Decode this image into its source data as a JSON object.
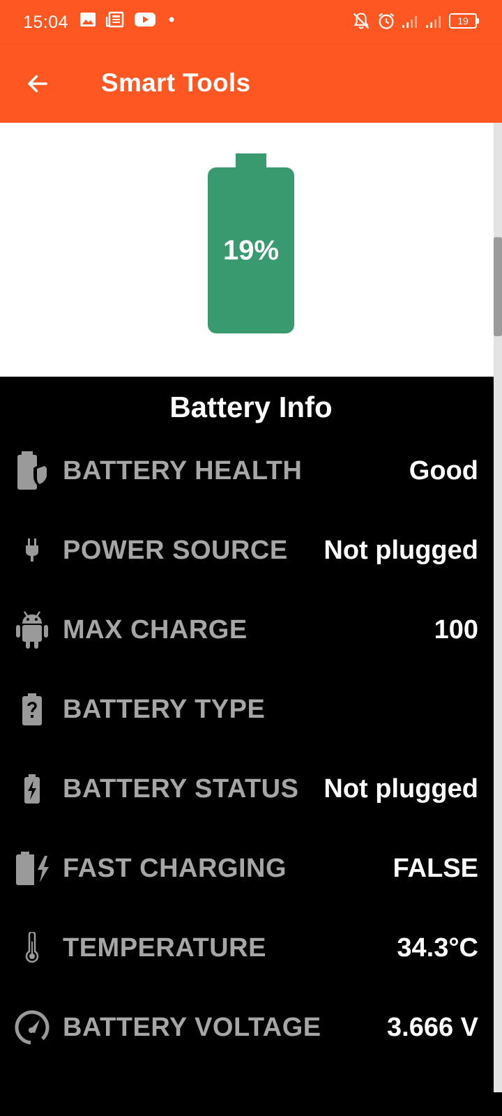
{
  "status_bar": {
    "time": "15:04",
    "battery": "19"
  },
  "app_bar": {
    "title": "Smart Tools"
  },
  "battery": {
    "percent_label": "19%",
    "level": 0.19,
    "color": "#3A9A6F"
  },
  "info": {
    "heading": "Battery Info",
    "rows": [
      {
        "icon": "battery-shield-icon",
        "label": "BATTERY HEALTH",
        "value": "Good"
      },
      {
        "icon": "power-plug-icon",
        "label": "POWER SOURCE",
        "value": "Not plugged"
      },
      {
        "icon": "android-icon",
        "label": "MAX CHARGE",
        "value": "100"
      },
      {
        "icon": "battery-unknown-icon",
        "label": "BATTERY TYPE",
        "value": ""
      },
      {
        "icon": "battery-charging-icon",
        "label": "BATTERY STATUS",
        "value": "Not plugged"
      },
      {
        "icon": "fast-charging-icon",
        "label": "FAST CHARGING",
        "value": "FALSE"
      },
      {
        "icon": "thermometer-icon",
        "label": "TEMPERATURE",
        "value": "34.3°C"
      },
      {
        "icon": "speedometer-icon",
        "label": "BATTERY VOLTAGE",
        "value": "3.666 V"
      }
    ]
  },
  "colors": {
    "accent": "#FF5722",
    "label": "#A6A6A6",
    "value": "#FFFFFF",
    "battery": "#3A9A6F"
  }
}
